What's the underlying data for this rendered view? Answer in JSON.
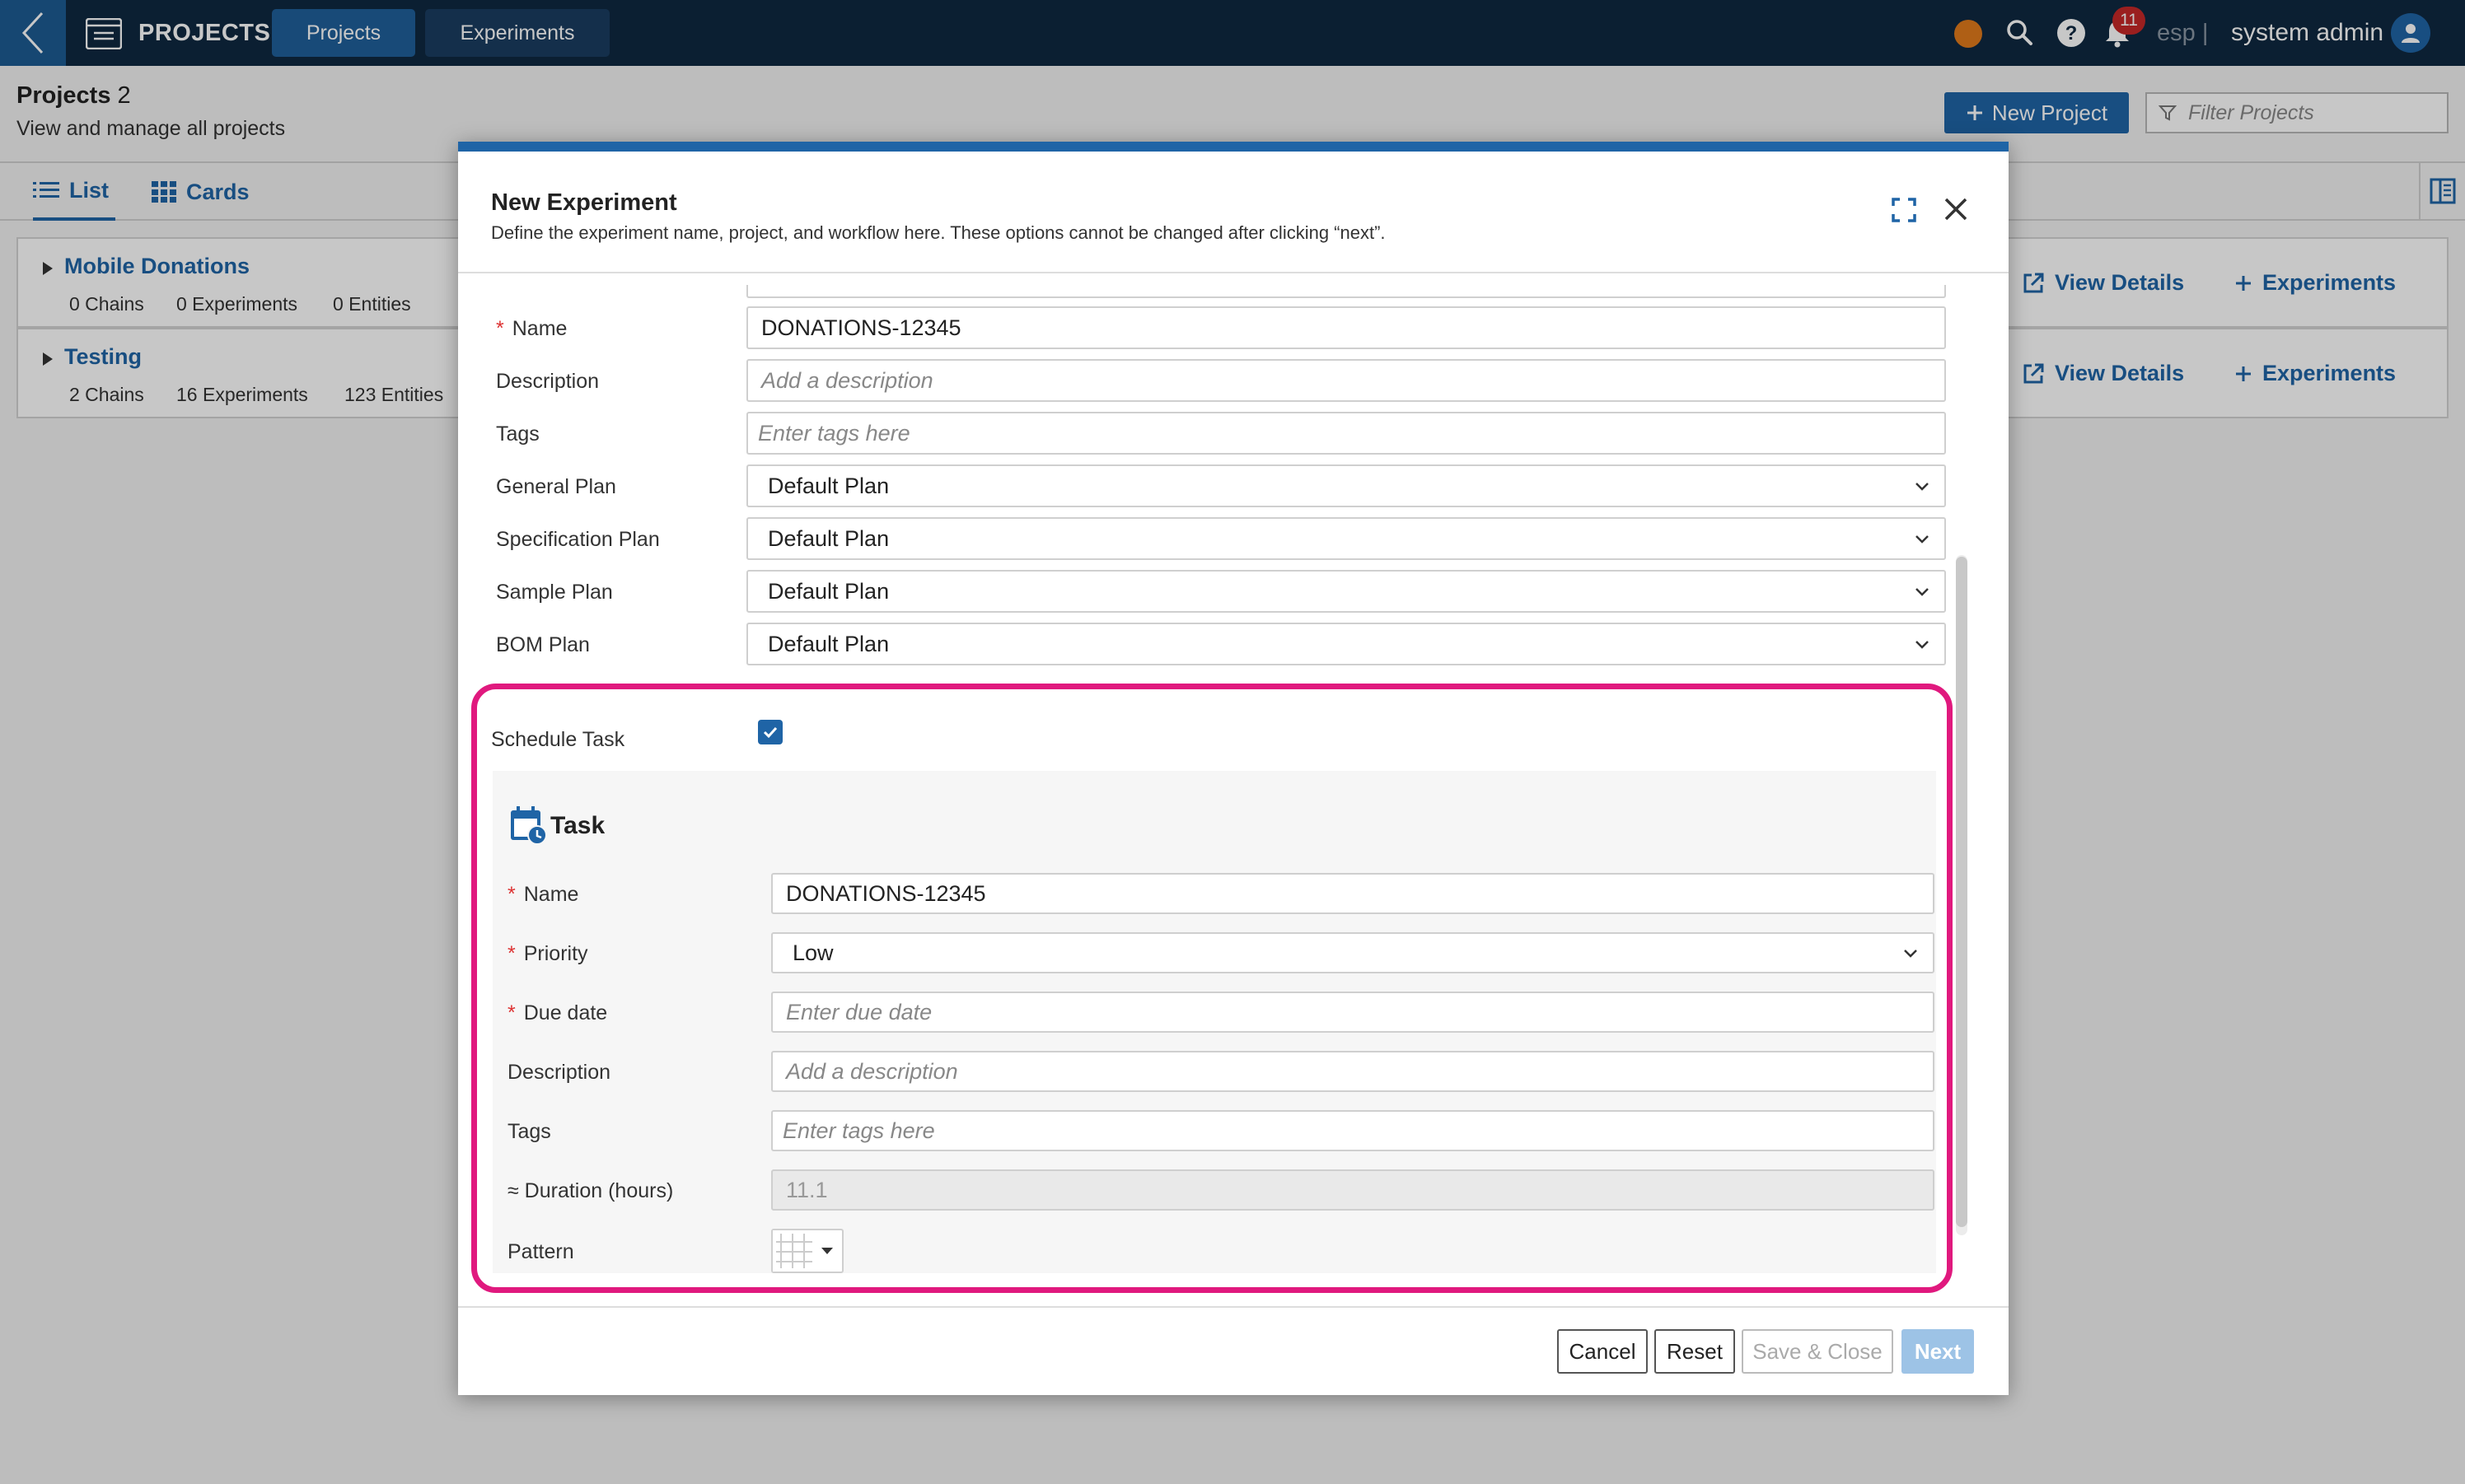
{
  "app": {
    "title": "PROJECTS"
  },
  "nav": {
    "tabs": [
      {
        "label": "Projects"
      },
      {
        "label": "Experiments"
      }
    ]
  },
  "topbar": {
    "notification_count": "11",
    "language": "esp",
    "separator": "|",
    "user_name": "system admin"
  },
  "page": {
    "title": "Projects",
    "count": "2",
    "subtitle": "View and manage all projects",
    "new_project_label": "New Project",
    "filter_placeholder": "Filter Projects"
  },
  "views": {
    "list_label": "List",
    "cards_label": "Cards"
  },
  "projects": [
    {
      "name": "Mobile Donations",
      "chains": "0 Chains",
      "experiments": "0 Experiments",
      "entities": "0 Entities",
      "view_details": "View Details",
      "experiments_link": "Experiments"
    },
    {
      "name": "Testing",
      "chains": "2 Chains",
      "experiments": "16 Experiments",
      "entities": "123 Entities",
      "view_details": "View Details",
      "experiments_link": "Experiments"
    }
  ],
  "modal": {
    "title": "New Experiment",
    "subtitle": "Define the experiment name, project, and workflow here. These options cannot be changed after clicking “next”.",
    "fields": {
      "name_label": "Name",
      "name_value": "DONATIONS-12345",
      "description_label": "Description",
      "description_placeholder": "Add a description",
      "tags_label": "Tags",
      "tags_placeholder": "Enter tags here",
      "general_plan_label": "General Plan",
      "general_plan_value": "Default Plan",
      "spec_plan_label": "Specification Plan",
      "spec_plan_value": "Default Plan",
      "sample_plan_label": "Sample Plan",
      "sample_plan_value": "Default Plan",
      "bom_plan_label": "BOM Plan",
      "bom_plan_value": "Default Plan"
    },
    "schedule_task_label": "Schedule Task",
    "schedule_task_checked": true,
    "task": {
      "title": "Task",
      "name_label": "Name",
      "name_value": "DONATIONS-12345",
      "priority_label": "Priority",
      "priority_value": "Low",
      "due_date_label": "Due date",
      "due_date_placeholder": "Enter due date",
      "description_label": "Description",
      "description_placeholder": "Add a description",
      "tags_label": "Tags",
      "tags_placeholder": "Enter tags here",
      "duration_label": "≈ Duration (hours)",
      "duration_value": "11.1",
      "pattern_label": "Pattern"
    },
    "buttons": {
      "cancel": "Cancel",
      "reset": "Reset",
      "save_close": "Save & Close",
      "next": "Next"
    }
  },
  "colors": {
    "topbar": "#0f2840",
    "accent": "#1f64a6",
    "highlight": "#e0197e",
    "status_dot": "#e07a1c",
    "required": "#dd3333"
  }
}
